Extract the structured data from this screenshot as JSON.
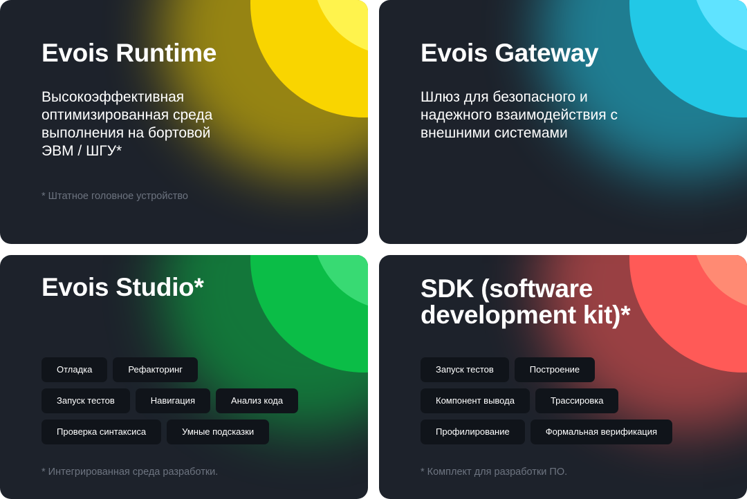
{
  "cards": [
    {
      "title": "Evois Runtime",
      "description": "Высокоэффективная оптимизированная среда выполнения на бортовой ЭВМ / ШГУ*",
      "footnote": "* Штатное головное устройство",
      "colors": {
        "outer": "#f9d500",
        "inner": "#fff34d"
      }
    },
    {
      "title": "Evois Gateway",
      "description": "Шлюз для безопасного и надежного взаимодействия с внешними системами",
      "colors": {
        "outer": "#22c8e6",
        "inner": "#5fe3ff"
      }
    },
    {
      "title": "Evois Studio*",
      "tags": [
        [
          "Отладка",
          "Рефакторинг"
        ],
        [
          "Запуск тестов",
          "Навигация",
          "Анализ кода"
        ],
        [
          "Проверка синтаксиса",
          "Умные подсказки"
        ]
      ],
      "footnote": "* Интегрированная среда разработки.",
      "colors": {
        "outer": "#0bbd47",
        "inner": "#38da73"
      }
    },
    {
      "title_lines": [
        "SDK (software",
        "development kit)*"
      ],
      "tags": [
        [
          "Запуск тестов",
          "Построение"
        ],
        [
          "Компонент вывода",
          "Трассировка"
        ],
        [
          "Профилирование",
          "Формальная верификация"
        ]
      ],
      "footnote": "* Комплект для разработки ПО.",
      "colors": {
        "outer": "#ff5a57",
        "inner": "#ff8a73"
      }
    }
  ]
}
